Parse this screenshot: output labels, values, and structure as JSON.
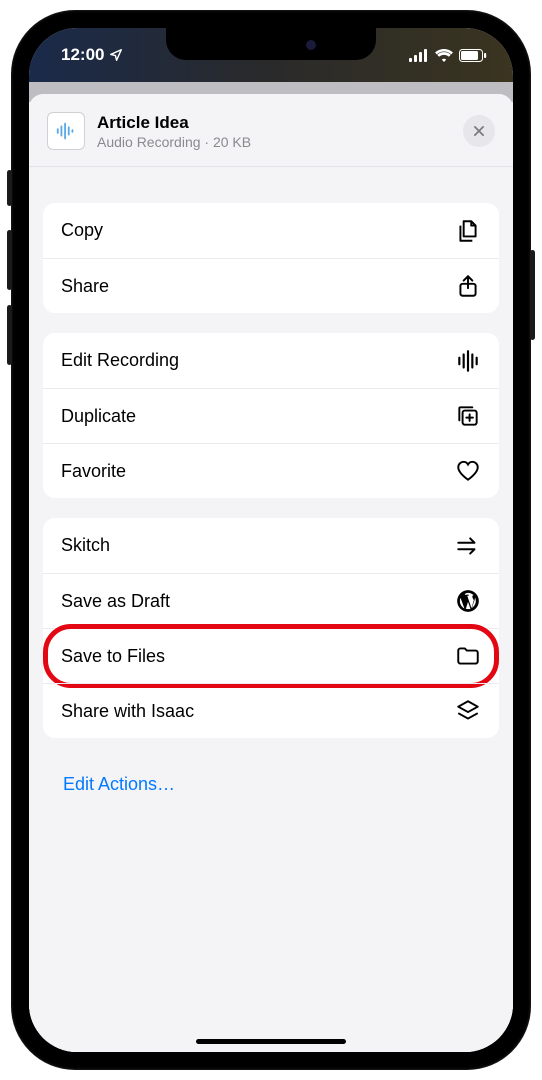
{
  "status": {
    "time": "12:00"
  },
  "header": {
    "title": "Article Idea",
    "subtitle_type": "Audio Recording",
    "subtitle_size": "20 KB"
  },
  "groups": [
    [
      {
        "id": "copy",
        "label": "Copy",
        "icon": "copy-icon"
      },
      {
        "id": "share",
        "label": "Share",
        "icon": "share-up-icon"
      }
    ],
    [
      {
        "id": "edit-recording",
        "label": "Edit Recording",
        "icon": "waveform-icon"
      },
      {
        "id": "duplicate",
        "label": "Duplicate",
        "icon": "duplicate-plus-icon"
      },
      {
        "id": "favorite",
        "label": "Favorite",
        "icon": "heart-icon"
      }
    ],
    [
      {
        "id": "skitch",
        "label": "Skitch",
        "icon": "skitch-arrow-icon"
      },
      {
        "id": "save-draft",
        "label": "Save as Draft",
        "icon": "wordpress-icon"
      },
      {
        "id": "save-to-files",
        "label": "Save to Files",
        "icon": "folder-icon",
        "highlight": true
      },
      {
        "id": "share-isaac",
        "label": "Share with Isaac",
        "icon": "layers-icon"
      }
    ]
  ],
  "footer": {
    "edit_actions": "Edit Actions…"
  }
}
